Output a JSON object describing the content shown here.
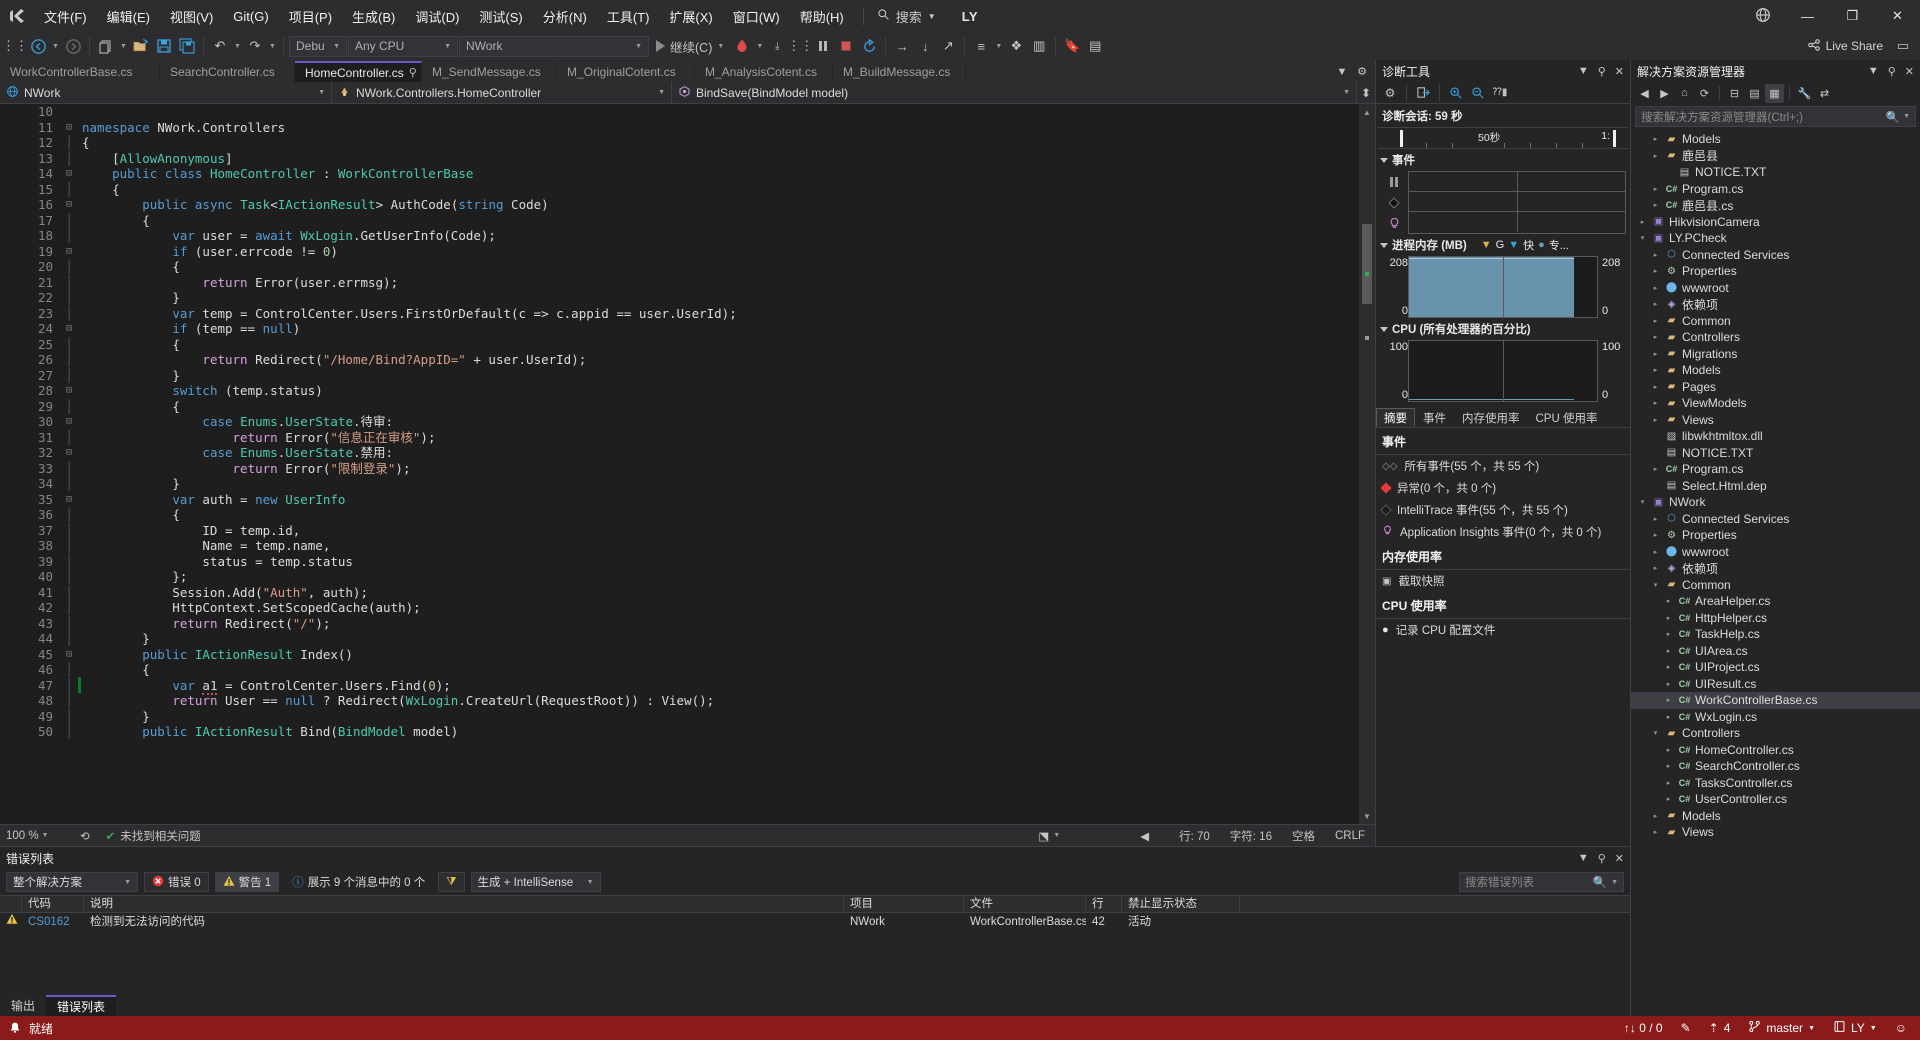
{
  "titlebar": {
    "logo_icon": "vs-logo-icon",
    "menus": [
      "文件(F)",
      "编辑(E)",
      "视图(V)",
      "Git(G)",
      "项目(P)",
      "生成(B)",
      "调试(D)",
      "测试(S)",
      "分析(N)",
      "工具(T)",
      "扩展(X)",
      "窗口(W)",
      "帮助(H)"
    ],
    "search_label": "搜索",
    "user": "LY",
    "min_label": "—",
    "max_label": "❐",
    "close_label": "✕"
  },
  "toolbar": {
    "nav_back": "←",
    "nav_fwd": "→",
    "new_item": "new-item-icon",
    "open": "open-file-icon",
    "save": "save-icon",
    "save_all": "save-all-icon",
    "undo": "↶",
    "redo": "↷",
    "config": "Debug",
    "platform": "Any CPU",
    "startup_project": "NWork",
    "continue_label": "继续(C)",
    "hot_reload_icon": "hot-reload-icon",
    "pause_icon": "pause-icon",
    "stop_icon": "stop-icon",
    "restart_icon": "restart-icon",
    "step_over": "→",
    "step_into": "↓",
    "step_out": "↗",
    "live_share": "Live Share"
  },
  "editor": {
    "tabs": [
      {
        "label": "WorkControllerBase.cs",
        "active": false
      },
      {
        "label": "SearchController.cs",
        "active": false
      },
      {
        "label": "HomeController.cs",
        "active": true
      },
      {
        "label": "M_SendMessage.cs",
        "active": false
      },
      {
        "label": "M_OriginalCotent.cs",
        "active": false
      },
      {
        "label": "M_AnalysisCotent.cs",
        "active": false
      },
      {
        "label": "M_BuildMessage.cs",
        "active": false
      }
    ],
    "pin_icon": "pin-icon",
    "close_icon": "✕",
    "navbar": {
      "project": "NWork",
      "type": "NWork.Controllers.HomeController",
      "member": "BindSave(BindModel model)"
    },
    "first_line": 10,
    "lines": [
      {
        "n": 10,
        "fold": "",
        "html": ""
      },
      {
        "n": 11,
        "fold": "-",
        "html": "<span class='kw'>namespace</span> <span class='pl'>NWork.Controllers</span>"
      },
      {
        "n": 12,
        "fold": "|",
        "html": "<span class='pl'>{</span>"
      },
      {
        "n": 13,
        "fold": "|",
        "html": "    <span class='pl'>[</span><span class='attr'>AllowAnonymous</span><span class='pl'>]</span>"
      },
      {
        "n": 14,
        "fold": "-",
        "html": "    <span class='kw'>public</span> <span class='kw'>class</span> <span class='cls'>HomeController</span> : <span class='cls'>WorkControllerBase</span>"
      },
      {
        "n": 15,
        "fold": "|",
        "html": "    <span class='pl'>{</span>"
      },
      {
        "n": 16,
        "fold": "-",
        "html": "        <span class='kw'>public</span> <span class='kw'>async</span> <span class='cls'>Task</span>&lt;<span class='cls'>IActionResult</span>&gt; <span class='pl'>AuthCode</span>(<span class='kw'>string</span> Code)"
      },
      {
        "n": 17,
        "fold": "|",
        "html": "        <span class='pl'>{</span>"
      },
      {
        "n": 18,
        "fold": "|",
        "html": "            <span class='kw'>var</span> user = <span class='kw'>await</span> <span class='cls'>WxLogin</span>.GetUserInfo(Code);"
      },
      {
        "n": 19,
        "fold": "-",
        "html": "            <span class='kw'>if</span> (user.errcode != <span class='num'>0</span>)"
      },
      {
        "n": 20,
        "fold": "|",
        "html": "            <span class='pl'>{</span>"
      },
      {
        "n": 21,
        "fold": "|",
        "html": "                <span class='ctl'>return</span> Error(user.errmsg);"
      },
      {
        "n": 22,
        "fold": "|",
        "html": "            <span class='pl'>}</span>"
      },
      {
        "n": 23,
        "fold": "|",
        "html": "            <span class='kw'>var</span> temp = ControlCenter.Users.FirstOrDefault(c =&gt; c.appid == user.UserId);"
      },
      {
        "n": 24,
        "fold": "-",
        "html": "            <span class='kw'>if</span> (temp == <span class='kw'>null</span>)"
      },
      {
        "n": 25,
        "fold": "|",
        "html": "            <span class='pl'>{</span>"
      },
      {
        "n": 26,
        "fold": "|",
        "html": "                <span class='ctl'>return</span> Redirect(<span class='str'>\"/Home/Bind?AppID=\"</span> + user.UserId);"
      },
      {
        "n": 27,
        "fold": "|",
        "html": "            <span class='pl'>}</span>"
      },
      {
        "n": 28,
        "fold": "-",
        "html": "            <span class='kw'>switch</span> (temp.status)"
      },
      {
        "n": 29,
        "fold": "|",
        "html": "            <span class='pl'>{</span>"
      },
      {
        "n": 30,
        "fold": "-",
        "html": "                <span class='kw'>case</span> <span class='cls'>Enums</span>.<span class='cls'>UserState</span>.待审:"
      },
      {
        "n": 31,
        "fold": "|",
        "html": "                    <span class='ctl'>return</span> Error(<span class='str'>\"信息正在审核\"</span>);"
      },
      {
        "n": 32,
        "fold": "-",
        "html": "                <span class='kw'>case</span> <span class='cls'>Enums</span>.<span class='cls'>UserState</span>.禁用:"
      },
      {
        "n": 33,
        "fold": "|",
        "html": "                    <span class='ctl'>return</span> Error(<span class='str'>\"限制登录\"</span>);"
      },
      {
        "n": 34,
        "fold": "|",
        "html": "            <span class='pl'>}</span>"
      },
      {
        "n": 35,
        "fold": "-",
        "html": "            <span class='kw'>var</span> auth = <span class='kw'>new</span> <span class='cls'>UserInfo</span>"
      },
      {
        "n": 36,
        "fold": "|",
        "html": "            <span class='pl'>{</span>"
      },
      {
        "n": 37,
        "fold": "|",
        "html": "                ID = temp.id,"
      },
      {
        "n": 38,
        "fold": "|",
        "html": "                Name = temp.name,"
      },
      {
        "n": 39,
        "fold": "|",
        "html": "                status = temp.status"
      },
      {
        "n": 40,
        "fold": "|",
        "html": "            <span class='pl'>};</span>"
      },
      {
        "n": 41,
        "fold": "|",
        "html": "            Session.Add(<span class='str'>\"Auth\"</span>, auth);"
      },
      {
        "n": 42,
        "fold": "|",
        "html": "            HttpContext.SetScopedCache(auth);"
      },
      {
        "n": 43,
        "fold": "|",
        "html": "            <span class='ctl'>return</span> Redirect(<span class='str'>\"/\"</span>);"
      },
      {
        "n": 44,
        "fold": "|",
        "html": "        <span class='pl'>}</span>"
      },
      {
        "n": 45,
        "fold": "-",
        "html": "        <span class='kw'>public</span> <span class='cls'>IActionResult</span> Index()"
      },
      {
        "n": 46,
        "fold": "|",
        "html": "        <span class='pl'>{</span>"
      },
      {
        "n": 47,
        "fold": "|",
        "html": "            <span class='kw'>var</span> <span class='err-sq'>a1</span> = ControlCenter.Users.Find(<span class='num'>0</span>);"
      },
      {
        "n": 48,
        "fold": "|",
        "html": "            <span class='ctl'>return</span> User == <span class='kw'>null</span> ? Redirect(<span class='cls'>WxLogin</span>.CreateUrl(RequestRoot)) : View();"
      },
      {
        "n": 49,
        "fold": "|",
        "html": "        <span class='pl'>}</span>"
      },
      {
        "n": 50,
        "fold": "|",
        "html": "        <span class='kw'>public</span> <span class='cls'>IActionResult</span> Bind(<span class='cls'>BindModel</span> model)"
      }
    ],
    "status": {
      "zoom": "100 %",
      "issues": "未找到相关问题",
      "line": "行: 70",
      "col": "字符: 16",
      "spaces": "空格",
      "eol": "CRLF"
    }
  },
  "errorlist": {
    "title": "错误列表",
    "scope": "整个解决方案",
    "errors_chip": "错误 0",
    "warnings_chip": "警告 1",
    "messages_text": "展示 9 个消息中的 0 个",
    "build_filter": "生成 + IntelliSense",
    "search_placeholder": "搜索错误列表",
    "columns": [
      "",
      "代码",
      "说明",
      "项目",
      "文件",
      "行",
      "禁止显示状态"
    ],
    "rows": [
      {
        "severity": "warning",
        "code": "CS0162",
        "desc": "检测到无法访问的代码",
        "project": "NWork",
        "file": "WorkControllerBase.cs",
        "line": "42",
        "suppression": "活动"
      }
    ],
    "tabs": [
      {
        "label": "输出",
        "active": false
      },
      {
        "label": "错误列表",
        "active": true
      }
    ]
  },
  "diagnostics": {
    "title": "诊断工具",
    "session_label": "诊断会话: 59 秒",
    "ruler": {
      "mid_label": "50秒",
      "right_label": "1:"
    },
    "events_section": "事件",
    "memory_section": "进程内存 (MB)",
    "memory_legend": [
      {
        "icon": "gc-marker-icon",
        "label": "G"
      },
      {
        "icon": "snapshot-marker-icon",
        "label": "快"
      },
      {
        "icon": "private-bytes-icon",
        "label": "专..."
      }
    ],
    "memory_max": "208",
    "memory_min": "0",
    "cpu_section": "CPU (所有处理器的百分比)",
    "cpu_max": "100",
    "cpu_min": "0",
    "tabs": [
      {
        "label": "摘要",
        "active": true
      },
      {
        "label": "事件",
        "active": false
      },
      {
        "label": "内存使用率",
        "active": false
      },
      {
        "label": "CPU 使用率",
        "active": false
      }
    ],
    "summary": {
      "events_header": "事件",
      "event_rows": [
        {
          "icon": "all-events-icon",
          "label": "所有事件(55 个，共 55 个)"
        },
        {
          "icon": "exception-icon",
          "label": "异常(0 个，共 0 个)"
        },
        {
          "icon": "intellitrace-icon",
          "label": "IntelliTrace 事件(55 个，共 55 个)"
        },
        {
          "icon": "app-insights-icon",
          "label": "Application Insights 事件(0 个，共 0 个)"
        }
      ],
      "memory_header": "内存使用率",
      "memory_rows": [
        {
          "icon": "snapshot-icon",
          "label": "截取快照"
        }
      ],
      "cpu_header": "CPU 使用率",
      "cpu_rows": [
        {
          "icon": "record-icon",
          "label": "记录 CPU 配置文件"
        }
      ]
    }
  },
  "solution_explorer": {
    "title": "解决方案资源管理器",
    "search_placeholder": "搜索解决方案资源管理器(Ctrl+;)",
    "toolbar_icons": [
      "back-icon",
      "forward-icon",
      "home-icon",
      "refresh-icon",
      "collapse-all-icon",
      "show-all-files-icon",
      "view-code-icon",
      "properties-icon",
      "sync-icon"
    ],
    "tree": [
      {
        "indent": 1,
        "tw": "▸",
        "icon": "folder",
        "glyph": "▰",
        "label": "Models"
      },
      {
        "indent": 1,
        "tw": "▸",
        "icon": "folder",
        "glyph": "▰",
        "label": "鹿邑县"
      },
      {
        "indent": 2,
        "tw": "",
        "icon": "txt",
        "glyph": "▤",
        "label": "NOTICE.TXT"
      },
      {
        "indent": 1,
        "tw": "▸",
        "icon": "cs",
        "glyph": "C#",
        "label": "Program.cs"
      },
      {
        "indent": 1,
        "tw": "▸",
        "icon": "cs",
        "glyph": "C#",
        "label": "鹿邑县.cs"
      },
      {
        "indent": 0,
        "tw": "▸",
        "icon": "proj",
        "glyph": "▣",
        "label": "HikvisionCamera"
      },
      {
        "indent": 0,
        "tw": "▾",
        "icon": "proj",
        "glyph": "▣",
        "label": "LY.PCheck"
      },
      {
        "indent": 1,
        "tw": "▸",
        "icon": "conn",
        "glyph": "⬡",
        "label": "Connected Services"
      },
      {
        "indent": 1,
        "tw": "▸",
        "icon": "prop",
        "glyph": "⚙",
        "label": "Properties"
      },
      {
        "indent": 1,
        "tw": "▸",
        "icon": "www",
        "glyph": "⬤",
        "label": "wwwroot"
      },
      {
        "indent": 1,
        "tw": "▸",
        "icon": "ref",
        "glyph": "◈",
        "label": "依赖项"
      },
      {
        "indent": 1,
        "tw": "▸",
        "icon": "folder",
        "glyph": "▰",
        "label": "Common"
      },
      {
        "indent": 1,
        "tw": "▸",
        "icon": "folder",
        "glyph": "▰",
        "label": "Controllers"
      },
      {
        "indent": 1,
        "tw": "▸",
        "icon": "folder",
        "glyph": "▰",
        "label": "Migrations"
      },
      {
        "indent": 1,
        "tw": "▸",
        "icon": "folder",
        "glyph": "▰",
        "label": "Models"
      },
      {
        "indent": 1,
        "tw": "▸",
        "icon": "folder",
        "glyph": "▰",
        "label": "Pages"
      },
      {
        "indent": 1,
        "tw": "▸",
        "icon": "folder",
        "glyph": "▰",
        "label": "ViewModels"
      },
      {
        "indent": 1,
        "tw": "▸",
        "icon": "folder",
        "glyph": "▰",
        "label": "Views"
      },
      {
        "indent": 1,
        "tw": "",
        "icon": "dll",
        "glyph": "▨",
        "label": "libwkhtmltox.dll"
      },
      {
        "indent": 1,
        "tw": "",
        "icon": "txt",
        "glyph": "▤",
        "label": "NOTICE.TXT"
      },
      {
        "indent": 1,
        "tw": "▸",
        "icon": "cs",
        "glyph": "C#",
        "label": "Program.cs"
      },
      {
        "indent": 1,
        "tw": "",
        "icon": "txt",
        "glyph": "▤",
        "label": "Select.Html.dep"
      },
      {
        "indent": 0,
        "tw": "▾",
        "icon": "proj",
        "glyph": "▣",
        "label": "NWork"
      },
      {
        "indent": 1,
        "tw": "▸",
        "icon": "conn",
        "glyph": "⬡",
        "label": "Connected Services"
      },
      {
        "indent": 1,
        "tw": "▸",
        "icon": "prop",
        "glyph": "⚙",
        "label": "Properties"
      },
      {
        "indent": 1,
        "tw": "▸",
        "icon": "www",
        "glyph": "⬤",
        "label": "wwwroot"
      },
      {
        "indent": 1,
        "tw": "▸",
        "icon": "ref",
        "glyph": "◈",
        "label": "依赖项"
      },
      {
        "indent": 1,
        "tw": "▾",
        "icon": "folder",
        "glyph": "▰",
        "label": "Common"
      },
      {
        "indent": 2,
        "tw": "▸",
        "icon": "cs",
        "glyph": "C#",
        "label": "AreaHelper.cs"
      },
      {
        "indent": 2,
        "tw": "▸",
        "icon": "cs",
        "glyph": "C#",
        "label": "HttpHelper.cs"
      },
      {
        "indent": 2,
        "tw": "▸",
        "icon": "cs",
        "glyph": "C#",
        "label": "TaskHelp.cs"
      },
      {
        "indent": 2,
        "tw": "▸",
        "icon": "cs",
        "glyph": "C#",
        "label": "UIArea.cs"
      },
      {
        "indent": 2,
        "tw": "▸",
        "icon": "cs",
        "glyph": "C#",
        "label": "UIProject.cs"
      },
      {
        "indent": 2,
        "tw": "▸",
        "icon": "cs",
        "glyph": "C#",
        "label": "UIResult.cs"
      },
      {
        "indent": 2,
        "tw": "▸",
        "icon": "cs",
        "glyph": "C#",
        "label": "WorkControllerBase.cs",
        "selected": true
      },
      {
        "indent": 2,
        "tw": "▸",
        "icon": "cs",
        "glyph": "C#",
        "label": "WxLogin.cs"
      },
      {
        "indent": 1,
        "tw": "▾",
        "icon": "folder",
        "glyph": "▰",
        "label": "Controllers"
      },
      {
        "indent": 2,
        "tw": "▸",
        "icon": "cs",
        "glyph": "C#",
        "label": "HomeController.cs"
      },
      {
        "indent": 2,
        "tw": "▸",
        "icon": "cs",
        "glyph": "C#",
        "label": "SearchController.cs"
      },
      {
        "indent": 2,
        "tw": "▸",
        "icon": "cs",
        "glyph": "C#",
        "label": "TasksController.cs"
      },
      {
        "indent": 2,
        "tw": "▸",
        "icon": "cs",
        "glyph": "C#",
        "label": "UserController.cs"
      },
      {
        "indent": 1,
        "tw": "▸",
        "icon": "folder",
        "glyph": "▰",
        "label": "Models"
      },
      {
        "indent": 1,
        "tw": "▸",
        "icon": "folder",
        "glyph": "▰",
        "label": "Views"
      }
    ]
  },
  "statusbar": {
    "ready": "就绪",
    "source_control_counts": "↑↓ 0 / 0",
    "warnings_count": "4",
    "branch": "master",
    "repo": "LY",
    "bell_icon": "notification-icon"
  },
  "colors": {
    "accent_tab": "#6a5acd",
    "status_bg": "#8b1a1a",
    "memory_fill": "#6e9ab5",
    "error_red": "#e03a3a",
    "warn_yellow": "#e8c547"
  }
}
